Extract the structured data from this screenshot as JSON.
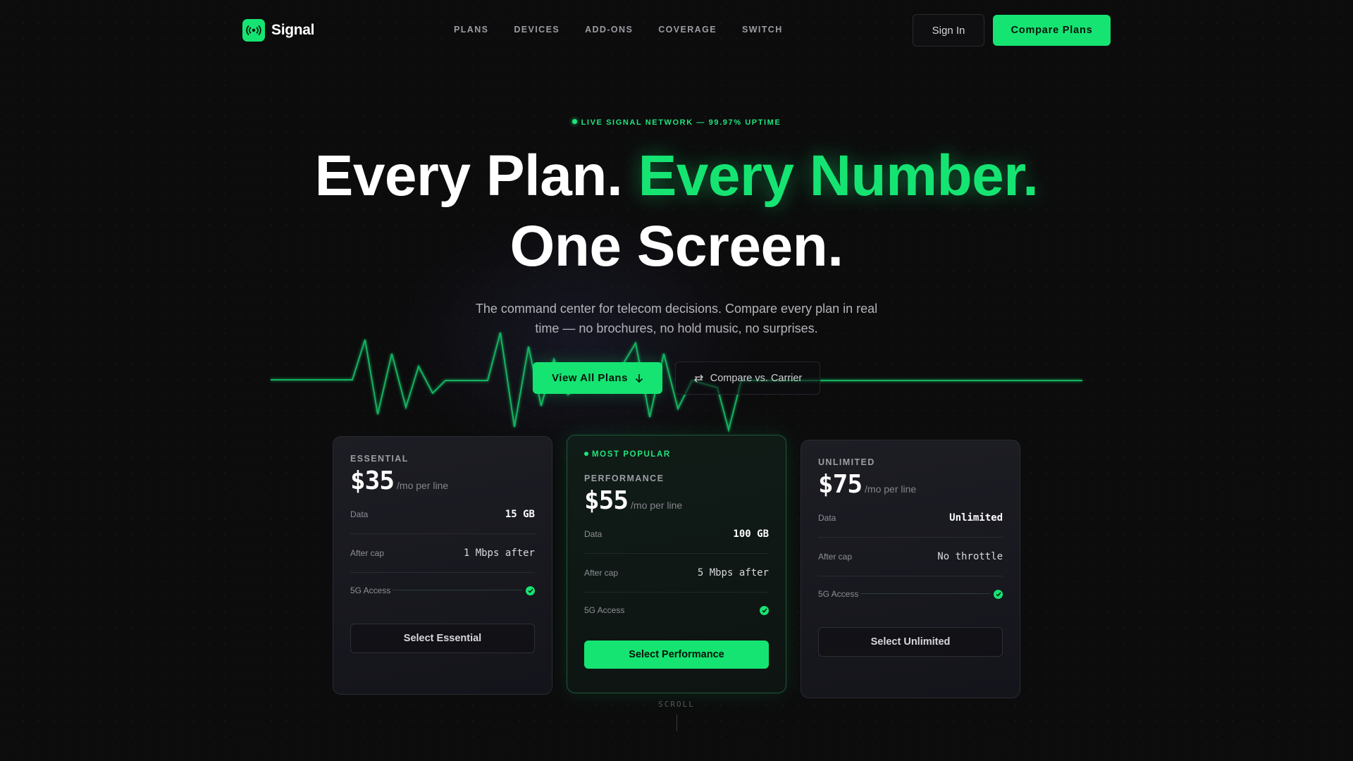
{
  "brand": {
    "name": "Signal",
    "accent": "#16e472"
  },
  "nav": {
    "links": [
      "PLANS",
      "DEVICES",
      "ADD-ONS",
      "COVERAGE",
      "SWITCH"
    ],
    "signin_label": "Sign In",
    "cta_label": "Compare Plans"
  },
  "hero": {
    "badge": "LIVE SIGNAL NETWORK — 99.97% UPTIME",
    "headline_1": "Every Plan.",
    "headline_accent": "Every Number.",
    "headline_2": "One Screen.",
    "subtitle": "The command center for telecom decisions. Compare every plan in real time — no brochures, no hold music, no surprises.",
    "primary_cta": "View All Plans",
    "secondary_cta": "Compare vs. Carrier"
  },
  "plans": [
    {
      "tier": "ESSENTIAL",
      "price": "$35",
      "per": "/mo per line",
      "specs": [
        {
          "label": "Data",
          "value": "15 GB"
        },
        {
          "label": "After cap",
          "value": "1 Mbps after"
        },
        {
          "label": "5G Access",
          "value": "check-icon"
        }
      ],
      "button": "Select Essential"
    },
    {
      "badge": "MOST POPULAR",
      "tier": "PERFORMANCE",
      "price": "$55",
      "per": "/mo per line",
      "specs": [
        {
          "label": "Data",
          "value": "100 GB"
        },
        {
          "label": "After cap",
          "value": "5 Mbps after"
        },
        {
          "label": "5G Access",
          "value": "check-icon"
        }
      ],
      "button": "Select Performance"
    },
    {
      "tier": "UNLIMITED",
      "price": "$75",
      "per": "/mo per line",
      "specs": [
        {
          "label": "Data",
          "value": "Unlimited"
        },
        {
          "label": "After cap",
          "value": "No throttle"
        },
        {
          "label": "5G Access",
          "value": "check-icon"
        }
      ],
      "button": "Select Unlimited"
    }
  ],
  "scroll_label": "SCROLL"
}
